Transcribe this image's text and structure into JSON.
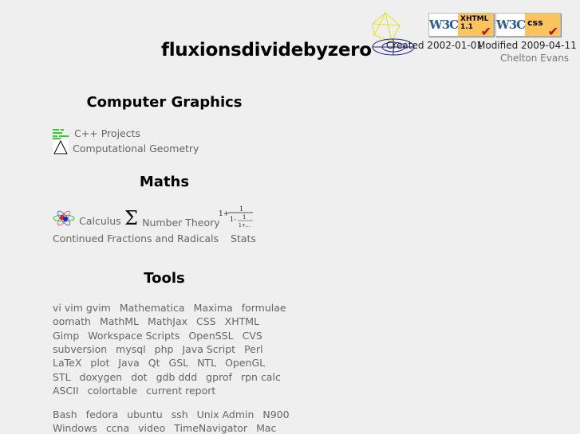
{
  "header": {
    "title": "fluxionsdividebyzero",
    "created": "Created 2002-01-01",
    "modified": "Modified 2009-04-11",
    "author": "Chelton Evans",
    "badges": [
      {
        "logo": "W3C",
        "label_line1": "XHTML",
        "label_line2": "1.1"
      },
      {
        "logo": "W3C",
        "label_line1": "css",
        "label_line2": ""
      }
    ]
  },
  "sections": {
    "graphics": {
      "heading": "Computer Graphics",
      "items": [
        {
          "label": "C++ Projects",
          "icon": "code-listing-icon"
        },
        {
          "label": "Computational Geometry",
          "icon": "triangle-icon"
        }
      ]
    },
    "maths": {
      "heading": "Maths",
      "items": [
        {
          "label": "Calculus",
          "icon": "atom-icon"
        },
        {
          "label": "Number Theory",
          "icon": "sigma-icon"
        },
        {
          "label": "Continued Fractions and Radicals",
          "icon": "continued-fraction-icon"
        },
        {
          "label": "Stats"
        }
      ],
      "fraction_text": {
        "a": "1+",
        "b": "1",
        "c": "1-",
        "d": "1",
        "e": "1+..."
      }
    },
    "tools": {
      "heading": "Tools",
      "rows": [
        [
          "vi vim gvim",
          "Mathematica",
          "Maxima",
          "formulae"
        ],
        [
          "oomath",
          "MathML",
          "MathJax",
          "CSS",
          "XHTML"
        ],
        [
          "Gimp",
          "Workspace Scripts",
          "OpenSSL",
          "CVS"
        ],
        [
          "subversion",
          "mysql",
          "php",
          "Java Script",
          "Perl"
        ],
        [
          "LaTeX",
          "plot",
          "Java",
          "Qt",
          "GSL",
          "NTL",
          "OpenGL"
        ],
        [
          "STL",
          "doxygen",
          "dot",
          "gdb ddd",
          "gprof",
          "rpn calc"
        ],
        [
          "ASCII",
          "colortable",
          "current report"
        ]
      ],
      "rows2": [
        [
          "Bash",
          "fedora",
          "ubuntu",
          "ssh",
          "Unix Admin",
          "N900"
        ],
        [
          "Windows",
          "ccna",
          "video",
          "TimeNavigator",
          "Mac"
        ]
      ]
    }
  }
}
